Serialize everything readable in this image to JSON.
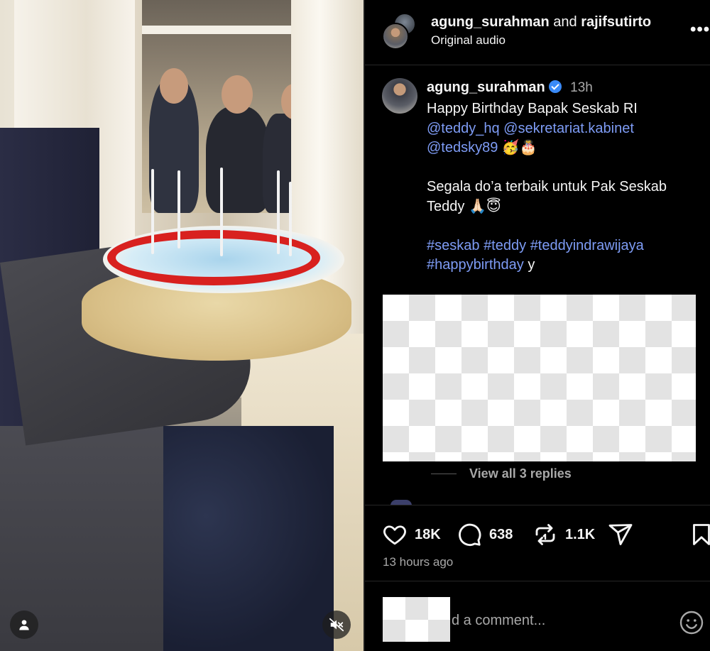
{
  "header": {
    "user1": "agung_surahman",
    "conjunction": "and",
    "user2": "rajifsutirto",
    "audio": "Original audio",
    "more_label": "•••"
  },
  "caption": {
    "username": "agung_surahman",
    "verified": true,
    "time": "13h",
    "line1": "Happy Birthday Bapak Seskab RI",
    "mention1": "@teddy_hq",
    "mention2": "@sekretariat.kabinet",
    "mention3": "@tedsky89",
    "emoji1": "🥳🎂",
    "line2": "Segala do’a terbaik untuk Pak Seskab",
    "line3": "Teddy",
    "emoji2": "🙏🏻😇",
    "tag1": "#seskab",
    "tag2": "#teddy",
    "tag3": "#teddyindrawijaya",
    "tag4": "#happybirthday",
    "trailing": "y"
  },
  "replies": {
    "label": "View all 3 replies"
  },
  "actions": {
    "likes": "18K",
    "comments": "638",
    "reposts": "1.1K",
    "icons": [
      "heart-icon",
      "comment-icon",
      "repost-icon",
      "share-icon",
      "bookmark-icon"
    ]
  },
  "posted": "13 hours ago",
  "comment_box": {
    "placeholder": "d a comment..."
  },
  "video": {
    "controls": [
      "user-icon",
      "mute-icon"
    ]
  },
  "colors": {
    "link": "#7e9cf5",
    "verified": "#3a8af7",
    "muted_text": "#a8a8a8",
    "background": "#000000"
  }
}
